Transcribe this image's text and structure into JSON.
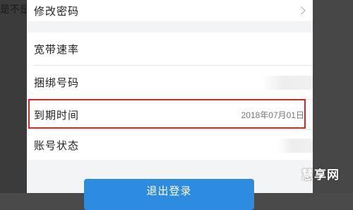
{
  "background_fragment": "是不是",
  "settings": {
    "change_password_label": "修改密码",
    "bandwidth_label": "宽带速率",
    "bound_number_label": "捆绑号码",
    "expiry_label": "到期时间",
    "expiry_value": "2018年07月01日",
    "account_status_label": "账号状态"
  },
  "logout_label": "退出登录",
  "watermark_text": "慧享网",
  "colors": {
    "highlight": "#d8282e",
    "button": "#2d8be0"
  }
}
